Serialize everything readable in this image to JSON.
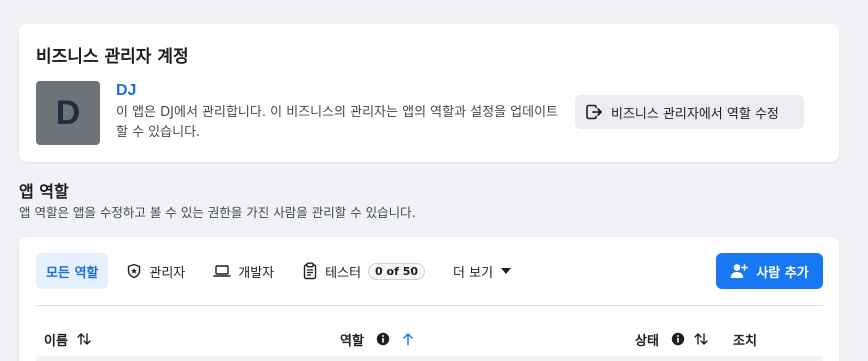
{
  "admin_account": {
    "title": "비즈니스 관리자 계정",
    "avatar_letter": "D",
    "business_name": "DJ",
    "description": "이 앱은 DJ에서 관리합니다. 이 비즈니스의 관리자는 앱의 역할과 설정을 업데이트할 수 있습니다.",
    "edit_roles_button": "비즈니스 관리자에서 역할 수정",
    "edit_icon": "external-link-icon"
  },
  "app_roles": {
    "title": "앱 역할",
    "description": "앱 역할은 앱을 수정하고 볼 수 있는 권한을 가진 사람을 관리할 수 있습니다."
  },
  "tabs": [
    {
      "label": "모든 역할",
      "active": true
    },
    {
      "label": "관리자",
      "icon": "shield-star-icon"
    },
    {
      "label": "개발자",
      "icon": "laptop-icon"
    },
    {
      "label": "테스터",
      "icon": "clipboard-icon",
      "badge": "0 of 50"
    },
    {
      "label": "더 보기",
      "icon": "caret-down-icon"
    }
  ],
  "add_person_button": "사람 추가",
  "table": {
    "columns": [
      {
        "label": "이름",
        "sort": "sort-both-icon"
      },
      {
        "label": "역할",
        "info": true,
        "sort": "sort-up-icon"
      },
      {
        "label": "상태",
        "info": true,
        "sort": "sort-both-icon"
      },
      {
        "label": "조치"
      }
    ]
  },
  "colors": {
    "accent": "#1877f2",
    "link": "#216fdb",
    "active_tab_bg": "#e7f0fd",
    "avatar_bg": "#6e7379"
  }
}
